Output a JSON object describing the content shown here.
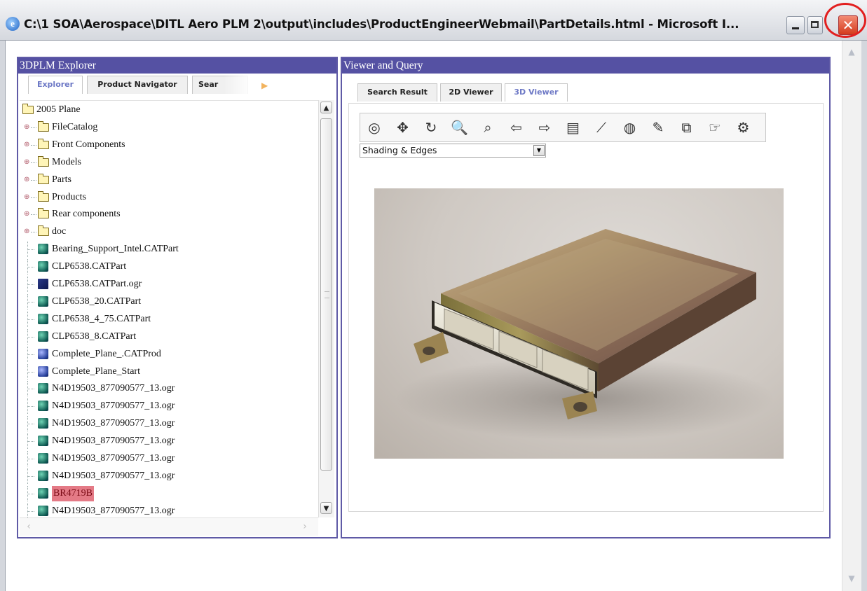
{
  "window": {
    "title": "C:\\1 SOA\\Aerospace\\DITL Aero PLM 2\\output\\includes\\ProductEngineerWebmail\\PartDetails.html - Microsoft I...",
    "icon": "ie-icon",
    "close_symbol": "✕"
  },
  "explorer": {
    "header": "3DPLM Explorer",
    "tabs": [
      {
        "label": "Explorer",
        "active": true
      },
      {
        "label": "Product Navigator",
        "active": false
      },
      {
        "label": "Sear",
        "active": false
      }
    ],
    "tree": [
      {
        "label": "2005 Plane",
        "icon": "folder-icon",
        "level": 0
      },
      {
        "label": "FileCatalog",
        "icon": "folder-icon",
        "level": 1
      },
      {
        "label": "Front Components",
        "icon": "folder-icon",
        "level": 1
      },
      {
        "label": "Models",
        "icon": "folder-icon",
        "level": 1
      },
      {
        "label": "Parts",
        "icon": "folder-icon",
        "level": 1
      },
      {
        "label": "Products",
        "icon": "folder-icon",
        "level": 1
      },
      {
        "label": "Rear components",
        "icon": "folder-icon",
        "level": 1
      },
      {
        "label": "doc",
        "icon": "folder-icon",
        "level": 1
      },
      {
        "label": "Bearing_Support_Intel.CATPart",
        "icon": "part-icon",
        "level": 1
      },
      {
        "label": "CLP6538.CATPart",
        "icon": "part-icon",
        "level": 1
      },
      {
        "label": "CLP6538.CATPart.ogr",
        "icon": "ogr-icon",
        "level": 1
      },
      {
        "label": "CLP6538_20.CATPart",
        "icon": "part-icon",
        "level": 1
      },
      {
        "label": "CLP6538_4_75.CATPart",
        "icon": "part-icon",
        "level": 1
      },
      {
        "label": "CLP6538_8.CATPart",
        "icon": "part-icon",
        "level": 1
      },
      {
        "label": "Complete_Plane_.CATProd",
        "icon": "product-icon",
        "level": 1
      },
      {
        "label": "Complete_Plane_Start",
        "icon": "product-icon",
        "level": 1
      },
      {
        "label": "N4D19503_877090577_13.ogr",
        "icon": "part-icon",
        "level": 1
      },
      {
        "label": "N4D19503_877090577_13.ogr",
        "icon": "part-icon",
        "level": 1
      },
      {
        "label": "N4D19503_877090577_13.ogr",
        "icon": "part-icon",
        "level": 1
      },
      {
        "label": "N4D19503_877090577_13.ogr",
        "icon": "part-icon",
        "level": 1
      },
      {
        "label": "N4D19503_877090577_13.ogr",
        "icon": "part-icon",
        "level": 1
      },
      {
        "label": "N4D19503_877090577_13.ogr",
        "icon": "part-icon",
        "level": 1
      },
      {
        "label": "BR4719B",
        "icon": "part-icon",
        "level": 1,
        "selected": true
      },
      {
        "label": "N4D19503_877090577_13.ogr",
        "icon": "part-icon",
        "level": 1
      }
    ]
  },
  "viewer": {
    "header": "Viewer and Query",
    "tabs": [
      {
        "label": "Search Result",
        "active": false
      },
      {
        "label": "2D Viewer",
        "active": false
      },
      {
        "label": "3D Viewer",
        "active": true
      }
    ],
    "toolbar": [
      {
        "name": "fit-all-icon",
        "glyph": "◎"
      },
      {
        "name": "pan-icon",
        "glyph": "✥"
      },
      {
        "name": "rotate-icon",
        "glyph": "↻"
      },
      {
        "name": "zoom-icon",
        "glyph": "🔍"
      },
      {
        "name": "zoom-area-icon",
        "glyph": "⌕"
      },
      {
        "name": "arrow-left-icon",
        "glyph": "⇦"
      },
      {
        "name": "arrow-right-icon",
        "glyph": "⇨"
      },
      {
        "name": "print-icon",
        "glyph": "▤"
      },
      {
        "name": "measure-icon",
        "glyph": "⟋"
      },
      {
        "name": "section-icon",
        "glyph": "◍"
      },
      {
        "name": "annotate-icon",
        "glyph": "✎"
      },
      {
        "name": "copy-icon",
        "glyph": "⧉"
      },
      {
        "name": "hand-icon",
        "glyph": "☞"
      },
      {
        "name": "settings-icon",
        "glyph": "⚙"
      }
    ],
    "render_mode": "Shading & Edges",
    "image": "ecu-module-photo"
  },
  "colors": {
    "panel_header": "#5551a3",
    "active_tab": "#6e79c6",
    "selection": "#e47a86",
    "close_highlight": "#e21f1f"
  }
}
